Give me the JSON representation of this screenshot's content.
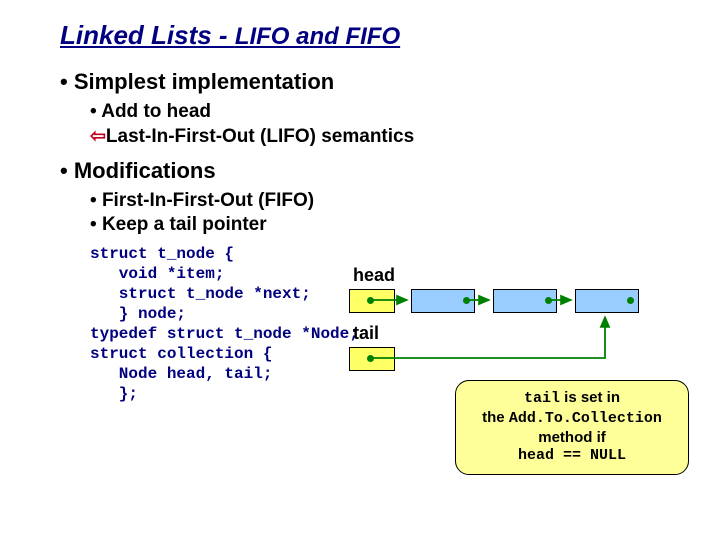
{
  "title_main": "Linked Lists - ",
  "title_sub": "LIFO and FIFO",
  "b1": "Simplest implementation",
  "b1a": "Add to head",
  "b1b": "Last-In-First-Out (LIFO) semantics",
  "b2": "Modifications",
  "b2a": "First-In-First-Out (FIFO)",
  "b2b": "Keep a tail pointer",
  "label_head": "head",
  "label_tail": "tail",
  "code": "struct t_node {\n   void *item;\n   struct t_node *next;\n   } node;\ntypedef struct t_node *Node;\nstruct collection {\n   Node head, tail;\n   };",
  "callout_l1a": "tail",
  "callout_l1b": " is set in",
  "callout_l2a": "the ",
  "callout_l2b": "Add.To.Collection",
  "callout_l3": "method if",
  "callout_l4": "head == NULL"
}
